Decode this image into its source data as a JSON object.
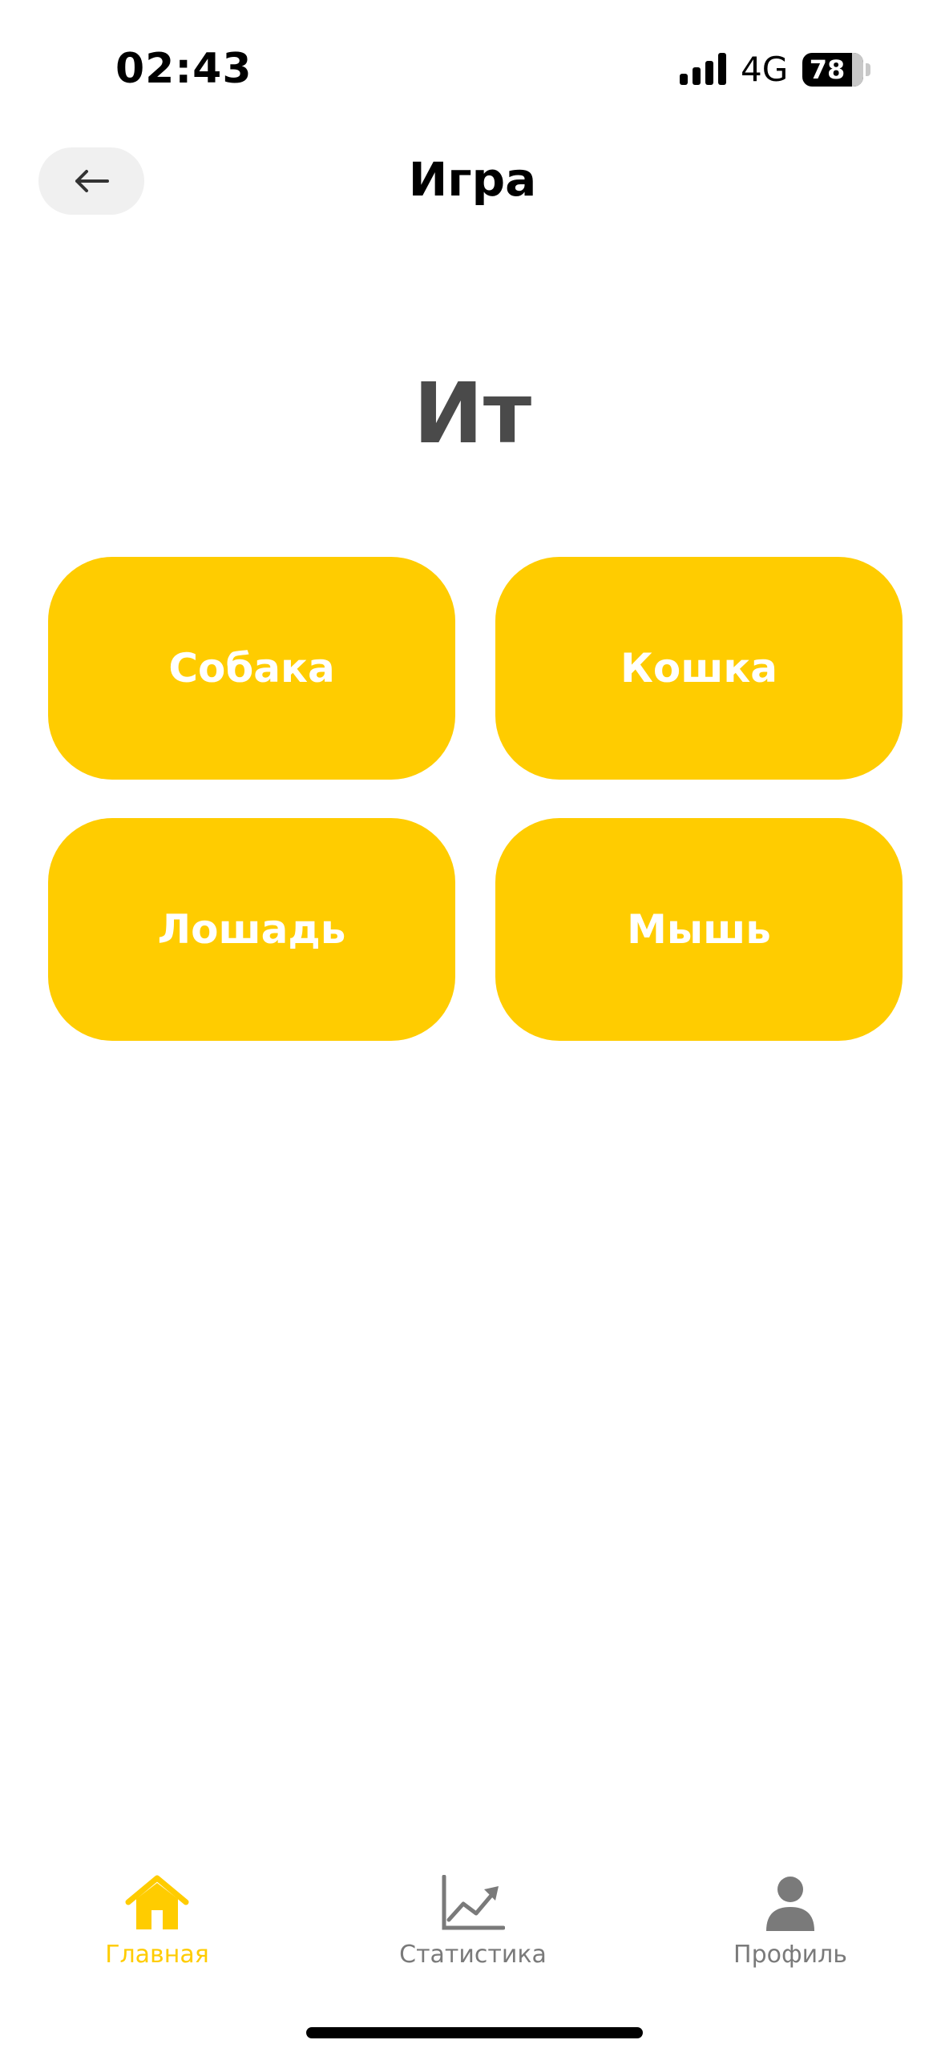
{
  "status_bar": {
    "time": "02:43",
    "network": "4G",
    "battery": "78"
  },
  "header": {
    "title": "Игра",
    "back_icon": "arrow-left-icon"
  },
  "prompt": {
    "word": "Ит"
  },
  "answers": [
    {
      "label": "Собака"
    },
    {
      "label": "Кошка"
    },
    {
      "label": "Лошадь"
    },
    {
      "label": "Мышь"
    }
  ],
  "tab_bar": {
    "items": [
      {
        "label": "Главная",
        "icon": "home-icon",
        "active": true
      },
      {
        "label": "Статистика",
        "icon": "chart-icon",
        "active": false
      },
      {
        "label": "Профиль",
        "icon": "user-icon",
        "active": false
      }
    ]
  },
  "colors": {
    "accent": "#ffcc00",
    "inactive": "#7a7a7a",
    "prompt": "#4a4a4a"
  }
}
